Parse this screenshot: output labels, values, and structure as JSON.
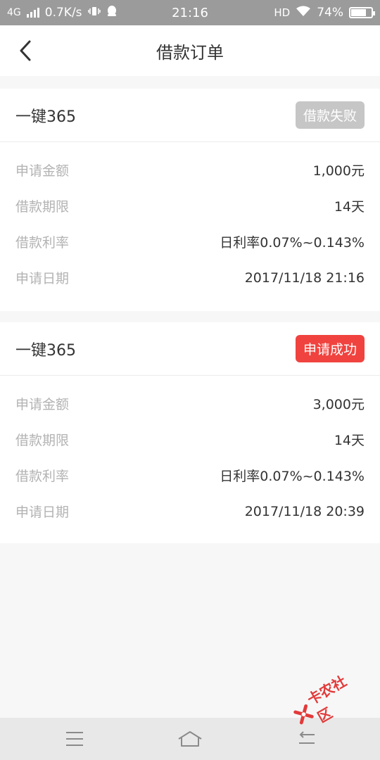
{
  "status_bar": {
    "network": "4G",
    "speed": "0.7K/s",
    "time": "21:16",
    "hd": "HD",
    "battery": "74%",
    "battery_level": 0.74
  },
  "header": {
    "title": "借款订单"
  },
  "orders": [
    {
      "name": "一键365",
      "status": "借款失败",
      "status_color": "#c6c6c6",
      "rows": [
        {
          "label": "申请金额",
          "value": "1,000元"
        },
        {
          "label": "借款期限",
          "value": "14天"
        },
        {
          "label": "借款利率",
          "value": "日利率0.07%~0.143%"
        },
        {
          "label": "申请日期",
          "value": "2017/11/18 21:16"
        }
      ]
    },
    {
      "name": "一键365",
      "status": "申请成功",
      "status_color": "#f0433f",
      "rows": [
        {
          "label": "申请金额",
          "value": "3,000元"
        },
        {
          "label": "借款期限",
          "value": "14天"
        },
        {
          "label": "借款利率",
          "value": "日利率0.07%~0.143%"
        },
        {
          "label": "申请日期",
          "value": "2017/11/18 20:39"
        }
      ]
    }
  ],
  "bottom_nav": {
    "icons": [
      "menu-icon",
      "home-icon",
      "back-icon"
    ]
  },
  "watermark": {
    "text": "卡农社区"
  }
}
